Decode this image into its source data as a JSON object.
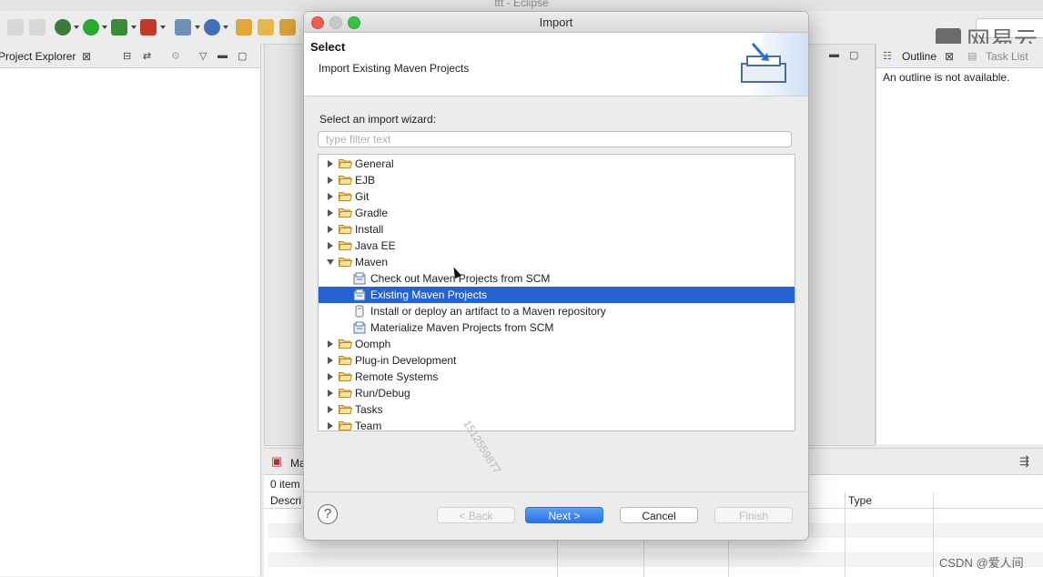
{
  "window": {
    "title": "ttt - Eclipse"
  },
  "workbench": {
    "project_explorer_tab": "Project Explorer",
    "outline_tab": "Outline",
    "task_list_tab": "Task List",
    "outline_message": "An outline is not available.",
    "bottom_tab": "Ma",
    "bottom_items": "0 item",
    "bottom_col_description": "Descri",
    "bottom_col_type": "Type",
    "logo_text": "网易云",
    "csdn_watermark": "CSDN @爱人间"
  },
  "dialog": {
    "title": "Import",
    "header_title": "Select",
    "header_description": "Import Existing Maven Projects",
    "wizard_label": "Select an import wizard:",
    "filter_placeholder": "type filter text",
    "tree": [
      {
        "label": "General",
        "expanded": false
      },
      {
        "label": "EJB",
        "expanded": false
      },
      {
        "label": "Git",
        "expanded": false
      },
      {
        "label": "Gradle",
        "expanded": false
      },
      {
        "label": "Install",
        "expanded": false
      },
      {
        "label": "Java EE",
        "expanded": false
      },
      {
        "label": "Maven",
        "expanded": true,
        "children": [
          {
            "label": "Check out Maven Projects from SCM",
            "selected": false
          },
          {
            "label": "Existing Maven Projects",
            "selected": true
          },
          {
            "label": "Install or deploy an artifact to a Maven repository",
            "selected": false
          },
          {
            "label": "Materialize Maven Projects from SCM",
            "selected": false
          }
        ]
      },
      {
        "label": "Oomph",
        "expanded": false
      },
      {
        "label": "Plug-in Development",
        "expanded": false
      },
      {
        "label": "Remote Systems",
        "expanded": false
      },
      {
        "label": "Run/Debug",
        "expanded": false
      },
      {
        "label": "Tasks",
        "expanded": false
      },
      {
        "label": "Team",
        "expanded": false
      }
    ],
    "watermark_text": "1512559877",
    "buttons": {
      "back": "< Back",
      "next": "Next >",
      "cancel": "Cancel",
      "finish": "Finish"
    },
    "help_label": "?"
  },
  "colors": {
    "selection": "#2463d1",
    "primary_button": "#2c74e6",
    "close": "#ee5d55",
    "minimize": "#c9c9c9",
    "zoom": "#39c248"
  }
}
